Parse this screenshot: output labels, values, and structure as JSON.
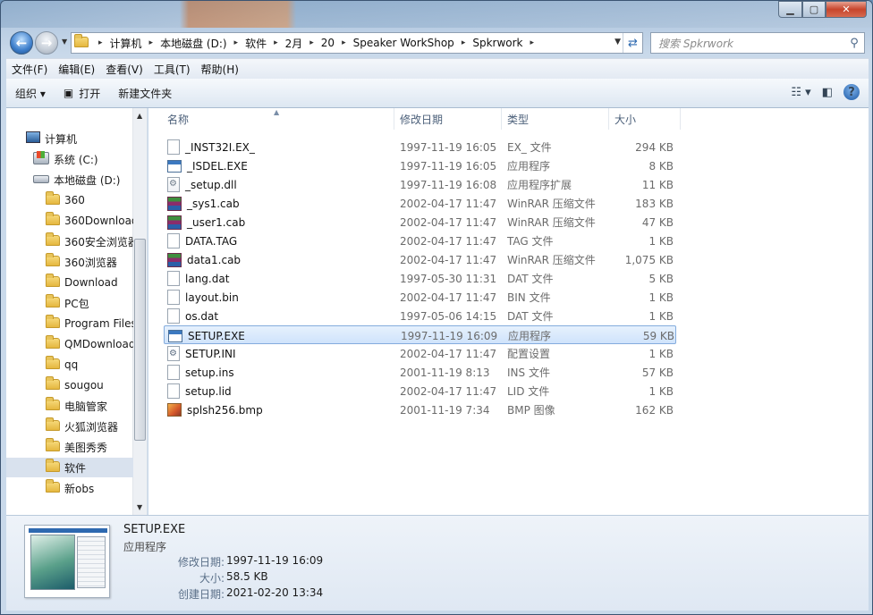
{
  "window": {
    "controls": {
      "minimize": "▁",
      "maximize": "▢",
      "close": "✕"
    }
  },
  "address": {
    "crumbs": [
      "计算机",
      "本地磁盘 (D:)",
      "软件",
      "2月",
      "20",
      "Speaker WorkShop",
      "Spkrwork"
    ]
  },
  "search": {
    "placeholder": "搜索 Spkrwork"
  },
  "menu": [
    "文件(F)",
    "编辑(E)",
    "查看(V)",
    "工具(T)",
    "帮助(H)"
  ],
  "toolbar": {
    "organize": "组织 ▾",
    "open": "打开",
    "new_folder": "新建文件夹"
  },
  "nav": {
    "items": [
      {
        "label": "计算机",
        "icon": "computer-icon"
      },
      {
        "label": "系统 (C:)",
        "icon": "system-drive-icon"
      },
      {
        "label": "本地磁盘 (D:)",
        "icon": "drive-icon"
      },
      {
        "label": "360",
        "icon": "folder-icon"
      },
      {
        "label": "360Download",
        "icon": "folder-icon"
      },
      {
        "label": "360安全浏览器",
        "icon": "folder-icon"
      },
      {
        "label": "360浏览器",
        "icon": "folder-icon"
      },
      {
        "label": "Download",
        "icon": "folder-icon"
      },
      {
        "label": "PC包",
        "icon": "folder-icon"
      },
      {
        "label": "Program Files",
        "icon": "folder-icon"
      },
      {
        "label": "QMDownload",
        "icon": "folder-icon"
      },
      {
        "label": "qq",
        "icon": "folder-icon"
      },
      {
        "label": "sougou",
        "icon": "folder-icon"
      },
      {
        "label": "电脑管家",
        "icon": "folder-icon"
      },
      {
        "label": "火狐浏览器",
        "icon": "folder-icon"
      },
      {
        "label": "美图秀秀",
        "icon": "folder-icon"
      },
      {
        "label": "软件",
        "icon": "folder-icon"
      },
      {
        "label": "新obs",
        "icon": "folder-icon"
      }
    ]
  },
  "columns": [
    "名称",
    "修改日期",
    "类型",
    "大小"
  ],
  "files": [
    {
      "name": "_INST32I.EX_",
      "date": "1997-11-19 16:05",
      "type": "EX_ 文件",
      "size": "294 KB",
      "icon": "file-icon"
    },
    {
      "name": "_ISDEL.EXE",
      "date": "1997-11-19 16:05",
      "type": "应用程序",
      "size": "8 KB",
      "icon": "exe-icon"
    },
    {
      "name": "_setup.dll",
      "date": "1997-11-19 16:08",
      "type": "应用程序扩展",
      "size": "11 KB",
      "icon": "dll-icon"
    },
    {
      "name": "_sys1.cab",
      "date": "2002-04-17 11:47",
      "type": "WinRAR 压缩文件",
      "size": "183 KB",
      "icon": "winrar-icon"
    },
    {
      "name": "_user1.cab",
      "date": "2002-04-17 11:47",
      "type": "WinRAR 压缩文件",
      "size": "47 KB",
      "icon": "winrar-icon"
    },
    {
      "name": "DATA.TAG",
      "date": "2002-04-17 11:47",
      "type": "TAG 文件",
      "size": "1 KB",
      "icon": "file-icon"
    },
    {
      "name": "data1.cab",
      "date": "2002-04-17 11:47",
      "type": "WinRAR 压缩文件",
      "size": "1,075 KB",
      "icon": "winrar-icon"
    },
    {
      "name": "lang.dat",
      "date": "1997-05-30 11:31",
      "type": "DAT 文件",
      "size": "5 KB",
      "icon": "file-icon"
    },
    {
      "name": "layout.bin",
      "date": "2002-04-17 11:47",
      "type": "BIN 文件",
      "size": "1 KB",
      "icon": "file-icon"
    },
    {
      "name": "os.dat",
      "date": "1997-05-06 14:15",
      "type": "DAT 文件",
      "size": "1 KB",
      "icon": "file-icon"
    },
    {
      "name": "SETUP.EXE",
      "date": "1997-11-19 16:09",
      "type": "应用程序",
      "size": "59 KB",
      "icon": "exe-icon"
    },
    {
      "name": "SETUP.INI",
      "date": "2002-04-17 11:47",
      "type": "配置设置",
      "size": "1 KB",
      "icon": "ini-icon"
    },
    {
      "name": "setup.ins",
      "date": "2001-11-19 8:13",
      "type": "INS 文件",
      "size": "57 KB",
      "icon": "file-icon"
    },
    {
      "name": "setup.lid",
      "date": "2002-04-17 11:47",
      "type": "LID 文件",
      "size": "1 KB",
      "icon": "file-icon"
    },
    {
      "name": "splsh256.bmp",
      "date": "2001-11-19 7:34",
      "type": "BMP 图像",
      "size": "162 KB",
      "icon": "bmp-icon"
    }
  ],
  "details": {
    "name": "SETUP.EXE",
    "type": "应用程序",
    "modified_label": "修改日期:",
    "modified": "1997-11-19 16:09",
    "size_label": "大小:",
    "size": "58.5 KB",
    "created_label": "创建日期:",
    "created": "2021-02-20 13:34"
  }
}
